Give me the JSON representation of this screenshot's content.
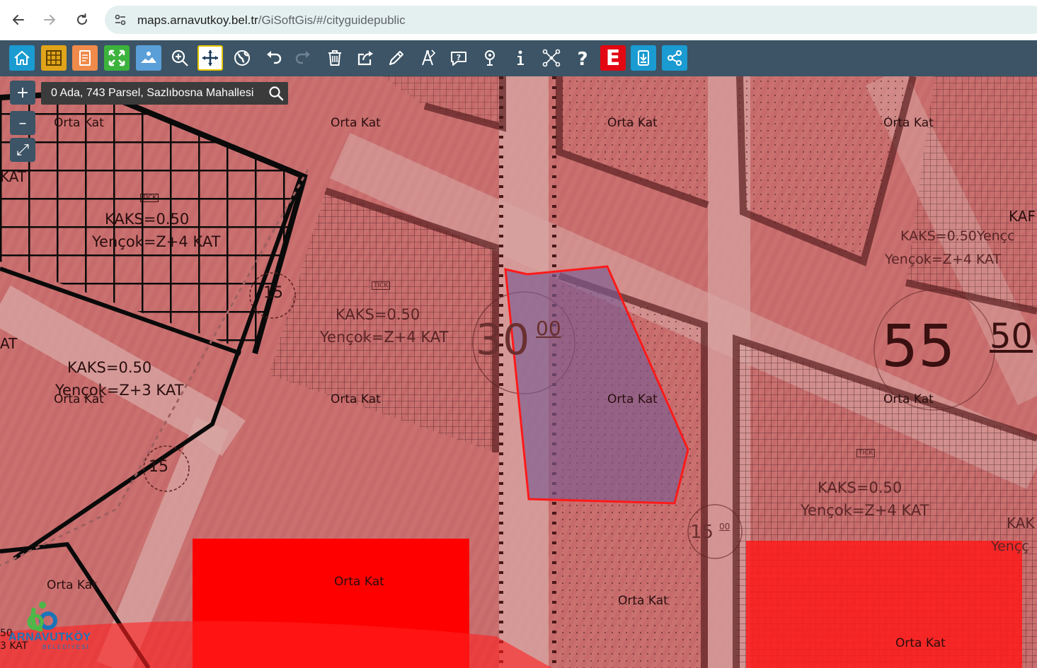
{
  "browser": {
    "url_domain": "maps.arnavutkoy.bel.tr",
    "url_path": "/GiSoftGis/#/cityguidepublic",
    "back_icon": "arrow-left-icon",
    "forward_icon": "arrow-right-icon",
    "reload_icon": "reload-icon"
  },
  "toolbar": {
    "tools": [
      {
        "name": "home-icon",
        "bg": "#1a9bd1"
      },
      {
        "name": "parcel-grid-icon",
        "bg": "#e0a419"
      },
      {
        "name": "report-icon",
        "bg": "#f08a4b"
      },
      {
        "name": "full-extent-icon",
        "bg": "#3cb33c"
      },
      {
        "name": "map-layers-icon",
        "bg": "#5a9fd8"
      },
      {
        "name": "zoom-in-icon"
      },
      {
        "name": "pan-icon",
        "bg": "#ffffff"
      },
      {
        "name": "globe-icon"
      },
      {
        "name": "undo-icon"
      },
      {
        "name": "redo-icon"
      },
      {
        "name": "trash-icon"
      },
      {
        "name": "share-out-icon"
      },
      {
        "name": "pencil-icon"
      },
      {
        "name": "measure-icon"
      },
      {
        "name": "comment-icon"
      },
      {
        "name": "location-pin-icon"
      },
      {
        "name": "info-icon"
      },
      {
        "name": "network-icon"
      },
      {
        "name": "help-icon"
      },
      {
        "name": "e-government-icon",
        "label": "E",
        "bg": "#e30613"
      },
      {
        "name": "download-document-icon",
        "bg": "#1a9bd1"
      },
      {
        "name": "share-icon",
        "bg": "#1a9bd1"
      }
    ]
  },
  "search": {
    "text": "0 Ada, 743 Parsel, Sazlıbosna Mahallesi"
  },
  "zoom": {
    "plus": "+",
    "minus": "–",
    "expand": "⤢"
  },
  "map": {
    "labels": {
      "orta_kat": "Orta Kat",
      "kaks_050": "KAKS=0.50",
      "yencok_z4": "Yençok=Z+4 KAT",
      "yencok_z3": "Yençok=Z+3 KAT",
      "kaks_partial": "KAKS=0.50Yençc",
      "yencok_partial": "Yençok=Z+4 KAT",
      "kat_a": "KAT",
      "kat_b": "AT",
      "kat_c": "KAF",
      "kaf_right": "KAK",
      "yenco_right": "Yençç",
      "tick": "TİCK",
      "road_15": "15",
      "road_15_small": "00",
      "road_30": "30",
      "road_30_small": "00",
      "road_55": "55",
      "road_55_small": "50",
      "left_edge_50": "50",
      "left_edge_kat": "3 KAT"
    },
    "colors": {
      "overlay_red": "#c0393b",
      "bright_red": "#ff0000",
      "selected_fill": "#7a5a90",
      "selected_stroke": "#ff1a1a"
    }
  },
  "logo": {
    "name": "ARNAVUTKÖY",
    "subtitle": "BELEDİYESİ"
  }
}
